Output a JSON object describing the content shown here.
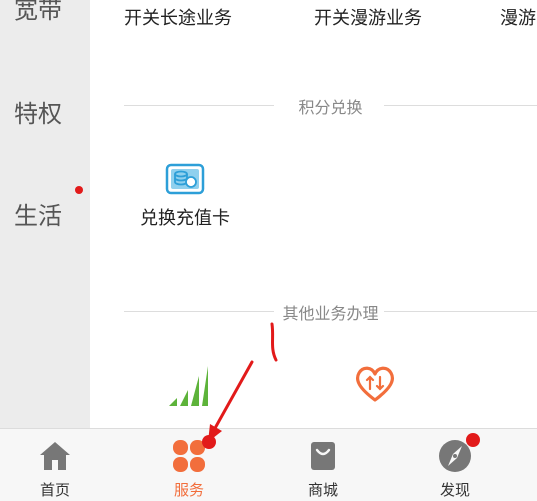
{
  "sidebar": {
    "items": [
      {
        "label": "宽带"
      },
      {
        "label": "特权"
      },
      {
        "label": "生活"
      }
    ]
  },
  "main": {
    "top_row": [
      "开关长途业务",
      "开关漫游业务",
      "漫游"
    ],
    "sections": [
      {
        "title": "积分兑换",
        "tiles": [
          {
            "label": "兑换充值卡",
            "icon": "card-exchange-icon"
          }
        ]
      },
      {
        "title": "其他业务办理",
        "tiles": [
          {
            "label": "",
            "icon": "signal-bars-icon"
          },
          {
            "label": "",
            "icon": "heart-transfer-icon"
          }
        ]
      }
    ]
  },
  "tabbar": {
    "tabs": [
      {
        "label": "首页",
        "icon": "home-icon"
      },
      {
        "label": "服务",
        "icon": "clover-icon",
        "active": true
      },
      {
        "label": "商城",
        "icon": "shopping-bag-icon"
      },
      {
        "label": "发现",
        "icon": "compass-icon"
      }
    ]
  },
  "colors": {
    "accent": "#f26e3c",
    "badge": "#e21a1a",
    "green": "#5db33a",
    "blue": "#2d9fd8"
  }
}
